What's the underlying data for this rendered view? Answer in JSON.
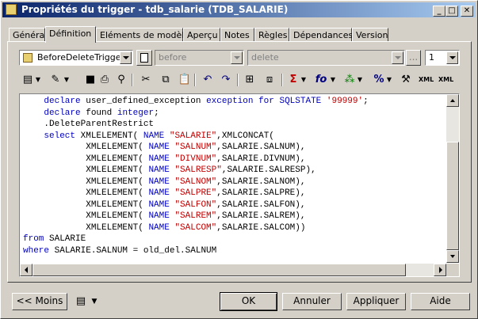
{
  "window": {
    "title": "Propriétés du trigger - tdb_salarie (TDB_SALARIE)",
    "minimize": "_",
    "maximize": "□",
    "close": "✕"
  },
  "tabs": [
    "Général",
    "Définition",
    "Eléments de modèle",
    "Aperçu",
    "Notes",
    "Règles",
    "Dépendances",
    "Version"
  ],
  "active_tab": "Définition",
  "selectors": {
    "template": "BeforeDeleteTrigger (c",
    "time": "before",
    "event": "delete",
    "ellipsis": "...",
    "order": "1"
  },
  "toolbar_icons": [
    "properties-icon",
    "edit-icon",
    "dropdown-icon",
    "save-icon",
    "print-icon",
    "find-icon",
    "cut-icon",
    "copy-icon",
    "paste-icon",
    "undo-icon",
    "redo-icon",
    "insert-icon",
    "run-icon",
    "sigma-icon",
    "function-icon",
    "tree-icon",
    "percent-icon",
    "tool-icon",
    "xml-icon",
    "xml-icon"
  ],
  "toolbar_glyphs": {
    "sigma": "Σ",
    "fo": "fo",
    "percent": "%"
  },
  "code_lines": [
    [
      {
        "t": "    "
      },
      {
        "t": "declare",
        "k": "kw"
      },
      {
        "t": " user_defined_exception "
      },
      {
        "t": "exception for SQLSTATE",
        "k": "kw"
      },
      {
        "t": " "
      },
      {
        "t": "'99999'",
        "k": "str"
      },
      {
        "t": ";"
      }
    ],
    [
      {
        "t": "    "
      },
      {
        "t": "declare",
        "k": "kw"
      },
      {
        "t": " found "
      },
      {
        "t": "integer",
        "k": "kw"
      },
      {
        "t": ";"
      }
    ],
    [
      {
        "t": "    .DeleteParentRestrict"
      }
    ],
    [
      {
        "t": "    "
      },
      {
        "t": "select",
        "k": "kw"
      },
      {
        "t": " XMLELEMENT( "
      },
      {
        "t": "NAME",
        "k": "kw"
      },
      {
        "t": " "
      },
      {
        "t": "\"SALARIE\"",
        "k": "str"
      },
      {
        "t": ",XMLCONCAT("
      }
    ],
    [
      {
        "t": "            XMLELEMENT( "
      },
      {
        "t": "NAME",
        "k": "kw"
      },
      {
        "t": " "
      },
      {
        "t": "\"SALNUM\"",
        "k": "str"
      },
      {
        "t": ",SALARIE.SALNUM),"
      }
    ],
    [
      {
        "t": "            XMLELEMENT( "
      },
      {
        "t": "NAME",
        "k": "kw"
      },
      {
        "t": " "
      },
      {
        "t": "\"DIVNUM\"",
        "k": "str"
      },
      {
        "t": ",SALARIE.DIVNUM),"
      }
    ],
    [
      {
        "t": "            XMLELEMENT( "
      },
      {
        "t": "NAME",
        "k": "kw"
      },
      {
        "t": " "
      },
      {
        "t": "\"SALRESP\"",
        "k": "str"
      },
      {
        "t": ",SALARIE.SALRESP),"
      }
    ],
    [
      {
        "t": "            XMLELEMENT( "
      },
      {
        "t": "NAME",
        "k": "kw"
      },
      {
        "t": " "
      },
      {
        "t": "\"SALNOM\"",
        "k": "str"
      },
      {
        "t": ",SALARIE.SALNOM),"
      }
    ],
    [
      {
        "t": "            XMLELEMENT( "
      },
      {
        "t": "NAME",
        "k": "kw"
      },
      {
        "t": " "
      },
      {
        "t": "\"SALPRE\"",
        "k": "str"
      },
      {
        "t": ",SALARIE.SALPRE),"
      }
    ],
    [
      {
        "t": "            XMLELEMENT( "
      },
      {
        "t": "NAME",
        "k": "kw"
      },
      {
        "t": " "
      },
      {
        "t": "\"SALFON\"",
        "k": "str"
      },
      {
        "t": ",SALARIE.SALFON),"
      }
    ],
    [
      {
        "t": "            XMLELEMENT( "
      },
      {
        "t": "NAME",
        "k": "kw"
      },
      {
        "t": " "
      },
      {
        "t": "\"SALREM\"",
        "k": "str"
      },
      {
        "t": ",SALARIE.SALREM),"
      }
    ],
    [
      {
        "t": "            XMLELEMENT( "
      },
      {
        "t": "NAME",
        "k": "kw"
      },
      {
        "t": " "
      },
      {
        "t": "\"SALCOM\"",
        "k": "str"
      },
      {
        "t": ",SALARIE.SALCOM))"
      }
    ],
    [
      {
        "t": "from",
        "k": "kw"
      },
      {
        "t": " SALARIE"
      }
    ],
    [
      {
        "t": "where",
        "k": "kw"
      },
      {
        "t": " SALARIE.SALNUM = old_del.SALNUM"
      }
    ]
  ],
  "buttons": {
    "less": "<< Moins",
    "ok": "OK",
    "cancel": "Annuler",
    "apply": "Appliquer",
    "help": "Aide"
  },
  "colors": {
    "keyword": "#0000c0",
    "string": "#c00000",
    "title_start": "#0a246a",
    "title_end": "#a6caf0"
  }
}
